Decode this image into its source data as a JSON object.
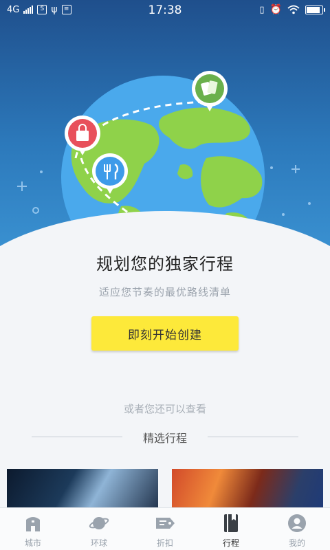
{
  "status_bar": {
    "network": "4G",
    "time": "17:38"
  },
  "hero": {
    "pins": [
      "shopping-bag-icon",
      "restaurant-icon",
      "ticket-icon"
    ],
    "colors": {
      "sky_top": "#1f4f8c",
      "sky_bottom": "#3b93d3",
      "ocean": "#4aa9ec",
      "land": "#8fd24a",
      "pin_red": "#e8505b",
      "pin_blue": "#3d9be9",
      "pin_green": "#6ab04c"
    }
  },
  "main": {
    "title": "规划您的独家行程",
    "subtitle": "适应您节奏的最优路线清单",
    "create_button": "即刻开始创建",
    "or_text": "或者您还可以查看",
    "section_label": "精选行程"
  },
  "tabbar": {
    "items": [
      {
        "label": "城市",
        "icon": "city-icon",
        "active": false
      },
      {
        "label": "环球",
        "icon": "planet-icon",
        "active": false
      },
      {
        "label": "折扣",
        "icon": "tag-icon",
        "active": false
      },
      {
        "label": "行程",
        "icon": "book-icon",
        "active": true
      },
      {
        "label": "我的",
        "icon": "user-icon",
        "active": false
      }
    ]
  }
}
